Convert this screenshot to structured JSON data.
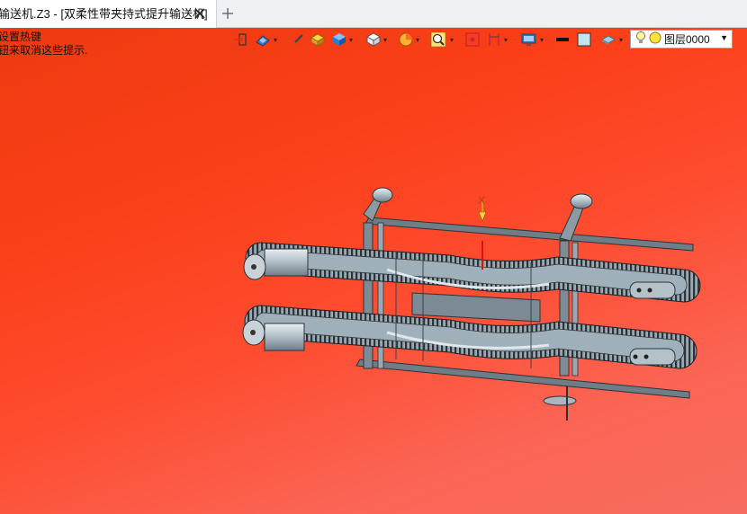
{
  "tab": {
    "title": "输送机.Z3 - [双柔性带夹持式提升输送机]",
    "close_glyph": "✕",
    "new_tab_glyph": "+"
  },
  "hint": {
    "line1": "设置热键",
    "line2": "钮来取消这些提示."
  },
  "toolbar": {
    "layer_label": "图层0000",
    "dropdown_glyph": "▾"
  },
  "colors": {
    "viewport_top": "#ee3a10",
    "viewport_bottom": "#f76c60",
    "model_frame": "#8c9aa4",
    "model_highlight": "#c8d2d8",
    "model_dark": "#323a40"
  }
}
